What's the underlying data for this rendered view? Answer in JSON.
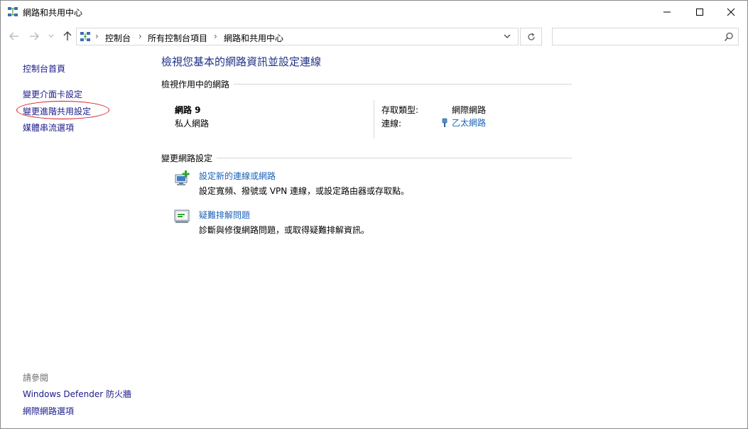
{
  "window": {
    "title": "網路和共用中心"
  },
  "address": {
    "crumbs": [
      "控制台",
      "所有控制台項目",
      "網路和共用中心"
    ],
    "search_placeholder": ""
  },
  "left_pane": {
    "home": "控制台首頁",
    "adapter_settings": "變更介面卡設定",
    "advanced_sharing": "變更進階共用設定",
    "media_streaming": "媒體串流選項",
    "see_also": "請參閱",
    "firewall": "Windows Defender 防火牆",
    "internet_options": "網際網路選項"
  },
  "main": {
    "title": "檢視您基本的網路資訊並設定連線",
    "active_networks_header": "檢視作用中的網路",
    "network_name": "網路 9",
    "network_type": "私人網路",
    "access_type_label": "存取類型:",
    "access_type_value": "網際網路",
    "connections_label": "連線:",
    "connections_value": "乙太網路",
    "change_settings_header": "變更網路設定",
    "tasks": [
      {
        "link": "設定新的連線或網路",
        "desc": "設定寬頻、撥號或 VPN 連線，或設定路由器或存取點。"
      },
      {
        "link": "疑難排解問題",
        "desc": "診斷與修復網路問題，或取得疑難排解資訊。"
      }
    ]
  },
  "icons": {
    "app": "network-center-icon",
    "ethernet": "ethernet-cable-icon"
  },
  "colors": {
    "link": "#1a62b8",
    "title": "#1e3287",
    "annotation": "#d9141a"
  }
}
